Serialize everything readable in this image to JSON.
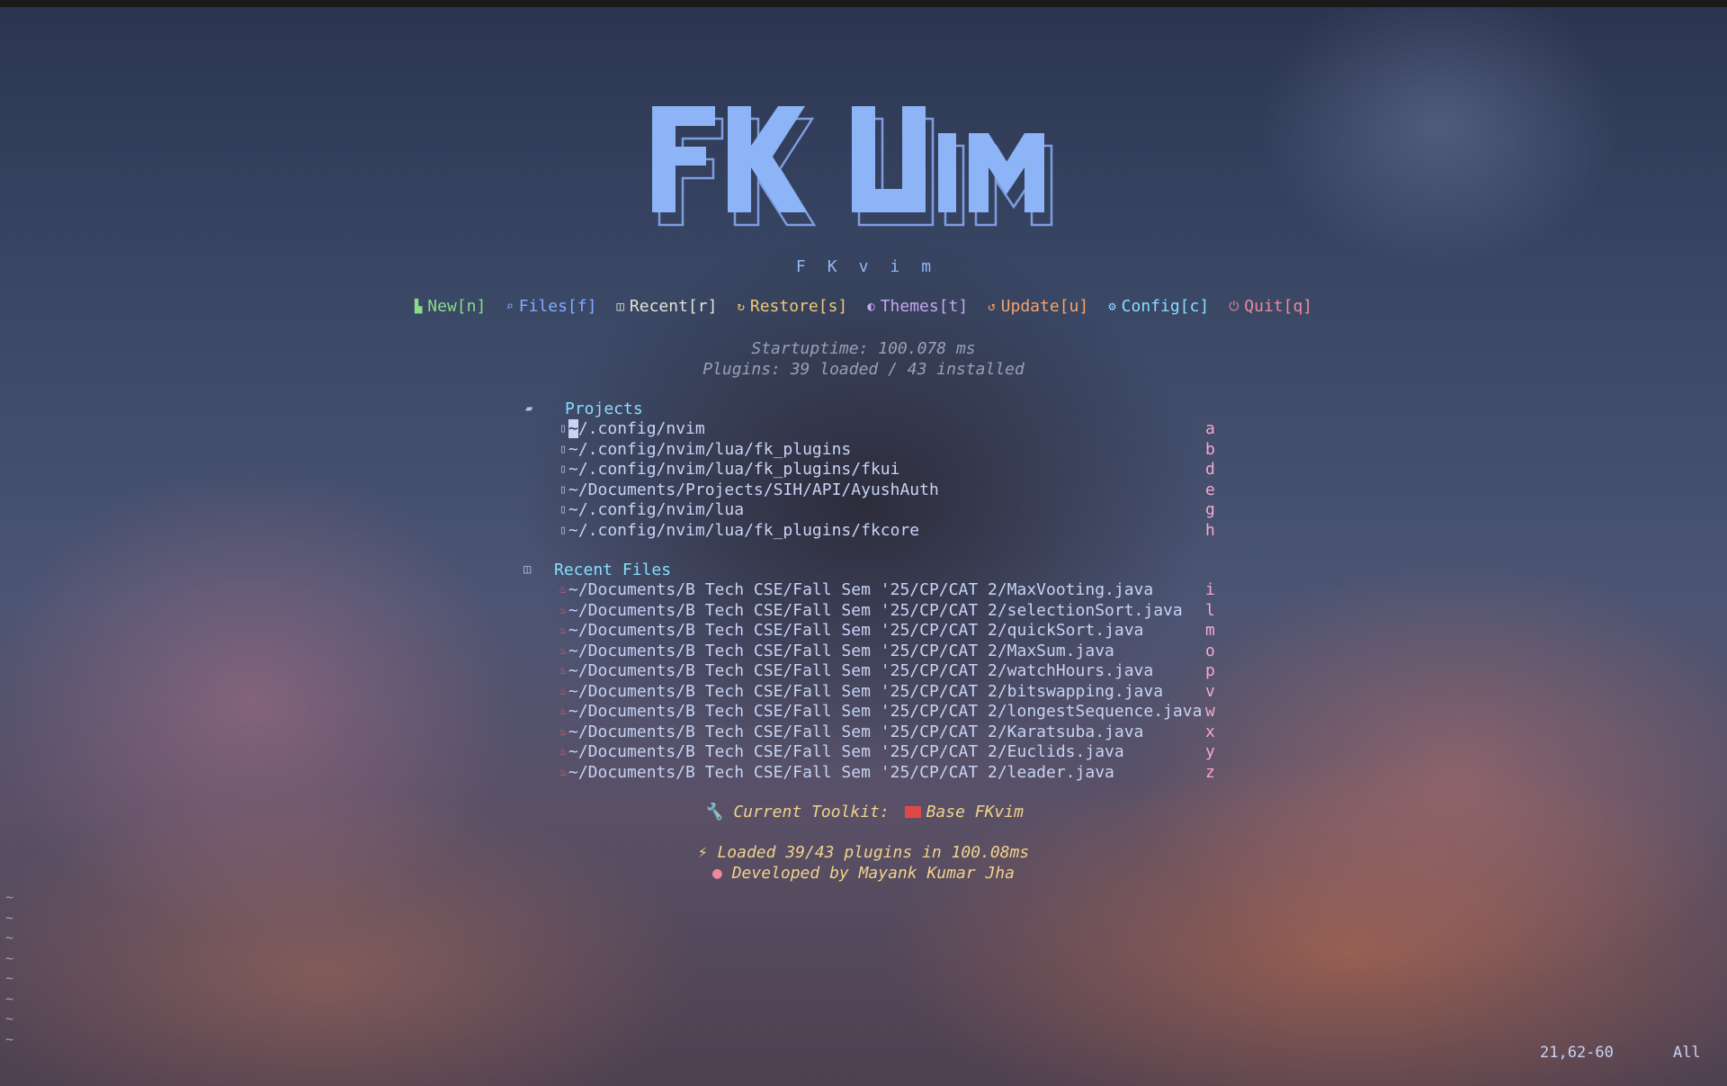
{
  "logo": {
    "text": "FK VIM"
  },
  "subtitle": "FKvim",
  "menu": [
    {
      "icon": "file-icon",
      "glyph": "▙",
      "label": "New[n]",
      "color": "#8bd98b"
    },
    {
      "icon": "file-search-icon",
      "glyph": "⌕",
      "label": "Files[f]",
      "color": "#82aaff"
    },
    {
      "icon": "history-icon",
      "glyph": "◫",
      "label": "Recent[r]",
      "color": "#e6e2d6"
    },
    {
      "icon": "restore-icon",
      "glyph": "↻",
      "label": "Restore[s]",
      "color": "#f0c77a"
    },
    {
      "icon": "palette-icon",
      "glyph": "◐",
      "label": "Themes[t]",
      "color": "#c4a7f0"
    },
    {
      "icon": "update-icon",
      "glyph": "↺",
      "label": "Update[u]",
      "color": "#f5a46b"
    },
    {
      "icon": "gear-icon",
      "glyph": "⚙",
      "label": "Config[c]",
      "color": "#89ddff"
    },
    {
      "icon": "power-icon",
      "glyph": "⏻",
      "label": "Quit[q]",
      "color": "#f0889b"
    }
  ],
  "stats": {
    "startup": "Startuptime: 100.078 ms",
    "plugins": "Plugins: 39 loaded / 43 installed"
  },
  "projects": {
    "header": "Projects",
    "items": [
      {
        "path": "~/.config/nvim",
        "key": "a"
      },
      {
        "path": "~/.config/nvim/lua/fk_plugins",
        "key": "b"
      },
      {
        "path": "~/.config/nvim/lua/fk_plugins/fkui",
        "key": "d"
      },
      {
        "path": "~/Documents/Projects/SIH/API/AyushAuth",
        "key": "e"
      },
      {
        "path": "~/.config/nvim/lua",
        "key": "g"
      },
      {
        "path": "~/.config/nvim/lua/fk_plugins/fkcore",
        "key": "h"
      }
    ]
  },
  "recent": {
    "header": "Recent Files",
    "items": [
      {
        "path": "~/Documents/B Tech CSE/Fall Sem '25/CP/CAT 2/MaxVooting.java",
        "key": "i"
      },
      {
        "path": "~/Documents/B Tech CSE/Fall Sem '25/CP/CAT 2/selectionSort.java",
        "key": "l"
      },
      {
        "path": "~/Documents/B Tech CSE/Fall Sem '25/CP/CAT 2/quickSort.java",
        "key": "m"
      },
      {
        "path": "~/Documents/B Tech CSE/Fall Sem '25/CP/CAT 2/MaxSum.java",
        "key": "o"
      },
      {
        "path": "~/Documents/B Tech CSE/Fall Sem '25/CP/CAT 2/watchHours.java",
        "key": "p"
      },
      {
        "path": "~/Documents/B Tech CSE/Fall Sem '25/CP/CAT 2/bitswapping.java",
        "key": "v"
      },
      {
        "path": "~/Documents/B Tech CSE/Fall Sem '25/CP/CAT 2/longestSequence.java",
        "key": "w"
      },
      {
        "path": "~/Documents/B Tech CSE/Fall Sem '25/CP/CAT 2/Karatsuba.java",
        "key": "x"
      },
      {
        "path": "~/Documents/B Tech CSE/Fall Sem '25/CP/CAT 2/Euclids.java",
        "key": "y"
      },
      {
        "path": "~/Documents/B Tech CSE/Fall Sem '25/CP/CAT 2/leader.java",
        "key": "z"
      }
    ]
  },
  "footer": {
    "toolkit_prefix": "Current Toolkit:",
    "toolkit_name": "Base FKvim",
    "loaded": "Loaded 39/43 plugins in 100.08ms",
    "developer": "Developed by Mayank Kumar Jha"
  },
  "status": {
    "position": "21,62-60",
    "scroll": "All"
  },
  "colors": {
    "accent_blue": "#8fb8f5",
    "key_pink": "#f5a8d0",
    "path_text": "#c8d3f5",
    "header_cyan": "#89ddff",
    "footer_gold": "#f0d28a",
    "java_icon": "#e06c75"
  }
}
